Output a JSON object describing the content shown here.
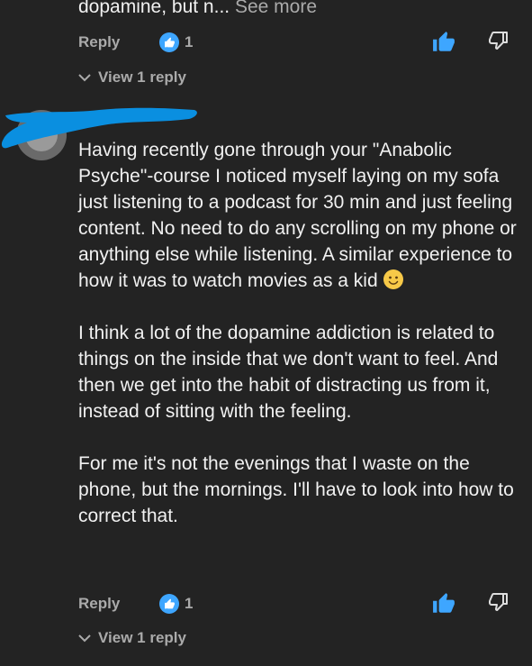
{
  "previous_comment": {
    "text_tail": "dopamine, but n...",
    "see_more_label": "See more",
    "reply_label": "Reply",
    "like_count": "1",
    "view_replies_label": "View 1 reply"
  },
  "comment": {
    "paragraphs": [
      "Having recently gone through your \"Anabolic Psyche\"-course I noticed myself laying on my sofa just listening to a podcast for 30 min and just feeling content. No need to do any scrolling on my phone or anything else while listening. A similar experience to how it was to watch movies as a kid",
      "I think a lot of the dopamine addiction is related to things on the inside that we don't want to feel. And then we get into the habit of distracting us from it, instead of sitting with the feeling.",
      "For me it's not the evenings that I waste on the phone, but the mornings. I'll have to look into how to correct that."
    ],
    "reply_label": "Reply",
    "like_count": "1",
    "view_replies_label": "View 1 reply"
  },
  "colors": {
    "background": "#232323",
    "accent_blue": "#3ea6ff",
    "text_primary": "#f1f1f1",
    "text_secondary": "#aaaaaa",
    "redaction": "#0a8fe0"
  },
  "icons": {
    "like_badge": "thumbs-up-badge-icon",
    "like": "thumbs-up-filled-icon",
    "dislike": "thumbs-down-outline-icon",
    "expand": "chevron-down-icon",
    "emoji": "slightly-smiling-face-emoji"
  }
}
